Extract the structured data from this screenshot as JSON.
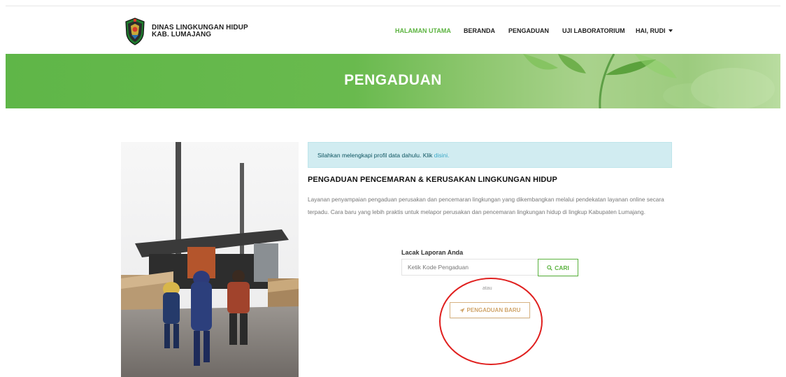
{
  "brand": {
    "line1": "DINAS LINGKUNGAN HIDUP",
    "line2": "KAB. LUMAJANG"
  },
  "nav": {
    "items": [
      {
        "label": "HALAMAN UTAMA",
        "active": true
      },
      {
        "label": "BERANDA",
        "active": false
      },
      {
        "label": "PENGADUAN",
        "active": false
      },
      {
        "label": "UJI LABORATORIUM",
        "active": false
      }
    ],
    "user_label": "HAI, RUDI"
  },
  "banner": {
    "title": "PENGADUAN"
  },
  "alert": {
    "text": "Silahkan melengkapi profil data dahulu. Klik ",
    "link_text": "disini."
  },
  "content": {
    "heading": "PENGADUAN PENCEMARAN & KERUSAKAN LINGKUNGAN HIDUP",
    "description": "Layanan penyampaian pengaduan perusakan dan pencemaran lingkungan yang dikembangkan melalui pendekatan layanan online secara terpadu. Cara baru yang lebih praktis untuk melapor perusakan dan pencemaran lingkungan hidup di lingkup Kabupaten Lumajang."
  },
  "tracking": {
    "label": "Lacak Laporan Anda",
    "input_placeholder": "Ketik Kode Pengaduan",
    "input_value": "",
    "search_label": "CARI",
    "or_text": "atau",
    "new_report_label": "PENGADUAN BARU"
  },
  "icons": {
    "search": "search-icon",
    "send": "paper-plane-icon",
    "dropdown": "caret-down-icon",
    "logo": "district-emblem"
  },
  "colors": {
    "accent_green": "#5bb33f",
    "banner_green": "#69ba4e",
    "alert_bg": "#d1ecf1",
    "alert_text": "#0c5460",
    "new_button": "#d0a56b",
    "annotation_red": "#e0201f"
  }
}
